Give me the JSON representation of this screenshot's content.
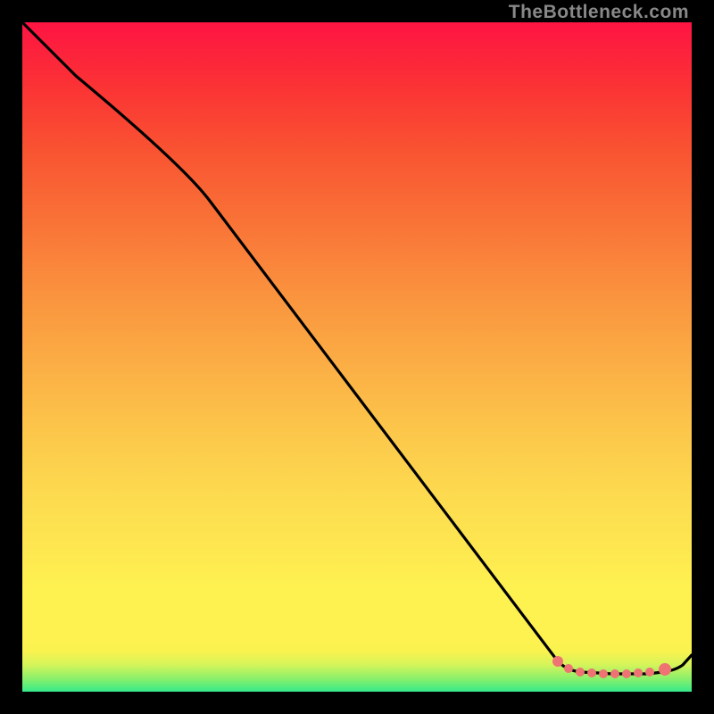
{
  "watermark": "TheBottleneck.com",
  "chart_data": {
    "type": "line",
    "title": "",
    "xlabel": "",
    "ylabel": "",
    "xlim": [
      0,
      100
    ],
    "ylim": [
      0,
      100
    ],
    "x": [
      0,
      8,
      28,
      80,
      80,
      82,
      85,
      87,
      89,
      91,
      94,
      96,
      98,
      100
    ],
    "values": [
      100,
      92,
      76,
      4.5,
      4.5,
      3.5,
      3,
      3,
      2.8,
      2.8,
      2.8,
      3,
      3.2,
      5.5
    ],
    "series_note": "Black curve descending from top-left to bottom-right then flattening near the bottom; salmon markers cluster along the flat bottom segment.",
    "marker_x": [
      80,
      82,
      85,
      87,
      89,
      91,
      94,
      96,
      98
    ],
    "marker_y": [
      4.5,
      3.5,
      3,
      3,
      2.8,
      2.8,
      2.8,
      3,
      3.2
    ],
    "large_marker": {
      "x": 96,
      "y": 3.2
    },
    "colors": {
      "line": "#000000",
      "marker": "#ef7373",
      "gradient_top": "#fe1443",
      "gradient_bottom": "#36ea8a"
    }
  }
}
